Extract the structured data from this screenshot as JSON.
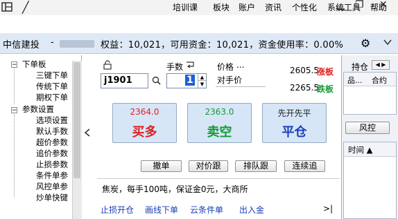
{
  "menu": {
    "items": [
      "培训课",
      "板块",
      "账户",
      "资讯",
      "个性化",
      "系统工具",
      "帮助"
    ]
  },
  "account": {
    "broker": "中信建投",
    "separator": "-",
    "summary": "权益：10,021，可用资金：10,021，资金使用率：0.00%"
  },
  "tree": {
    "groups": [
      {
        "label": "下单板",
        "expander": "−",
        "children": [
          "三键下单",
          "传统下单",
          "期权下单"
        ]
      },
      {
        "label": "参数设置",
        "expander": "−",
        "children": [
          "选项设置",
          "默认手数",
          "超价参数",
          "追价参数",
          "止损参数",
          "条件单参",
          "风控单参",
          "炒单快键"
        ]
      }
    ]
  },
  "order": {
    "contract": "j1901",
    "qty_label": "手数",
    "qty_value": "1",
    "price_label": "价格",
    "price_more": "...",
    "price_value": "对手价",
    "limit_up_price": "2605.5",
    "limit_up_label": "涨板",
    "limit_down_price": "2265.5",
    "limit_down_label": "跌板",
    "buy": {
      "price": "2364.0",
      "label": "买多"
    },
    "sell": {
      "price": "2363.0",
      "label": "卖空"
    },
    "close": {
      "price": "先开先平",
      "label": "平仓"
    },
    "actions": [
      "撤单",
      "对价跟",
      "排队跟",
      "连续追"
    ],
    "info": "焦炭，每手100吨，保证金0元，大商所",
    "links": [
      "止损开仓",
      "画线下单",
      "云条件单",
      "出入金"
    ],
    "links_arrow": ">|"
  },
  "right": {
    "tab_label": "持仓",
    "col1": "品...",
    "col2": "合约",
    "risk_button": "风控",
    "time_header": "时间 ▲"
  },
  "colors": {
    "red": "#e02020",
    "green": "#139a33",
    "link": "#1a3fb8"
  }
}
